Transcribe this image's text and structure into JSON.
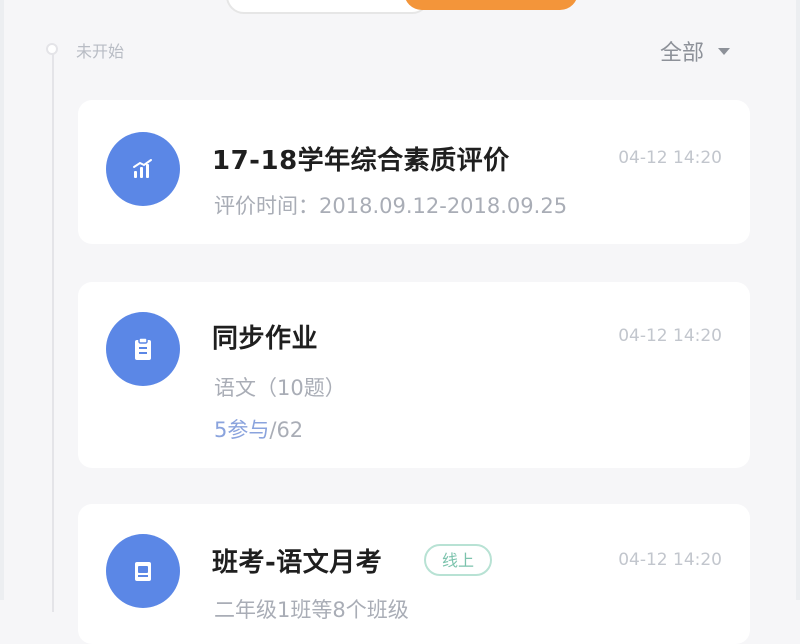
{
  "header": {
    "status_label": "未开始",
    "filter_label": "全部"
  },
  "cards": [
    {
      "title": "17-18学年综合素质评价",
      "time": "04-12 14:20",
      "subtitle": "评价时间：2018.09.12-2018.09.25",
      "icon": "chart-icon"
    },
    {
      "title": "同步作业",
      "time": "04-12 14:20",
      "subtitle": "语文（10题）",
      "count_highlight": "5参与",
      "count_total": "/62",
      "icon": "clipboard-icon"
    },
    {
      "title": "班考-语文月考",
      "badge": "线上",
      "time": "04-12 14:20",
      "subtitle": "二年级1班等8个班级",
      "icon": "exam-icon"
    }
  ],
  "colors": {
    "accent_orange": "#f3953a",
    "icon_blue": "#5b87e6",
    "badge_green": "#7cc3ad",
    "count_blue": "#8aa3dd"
  }
}
